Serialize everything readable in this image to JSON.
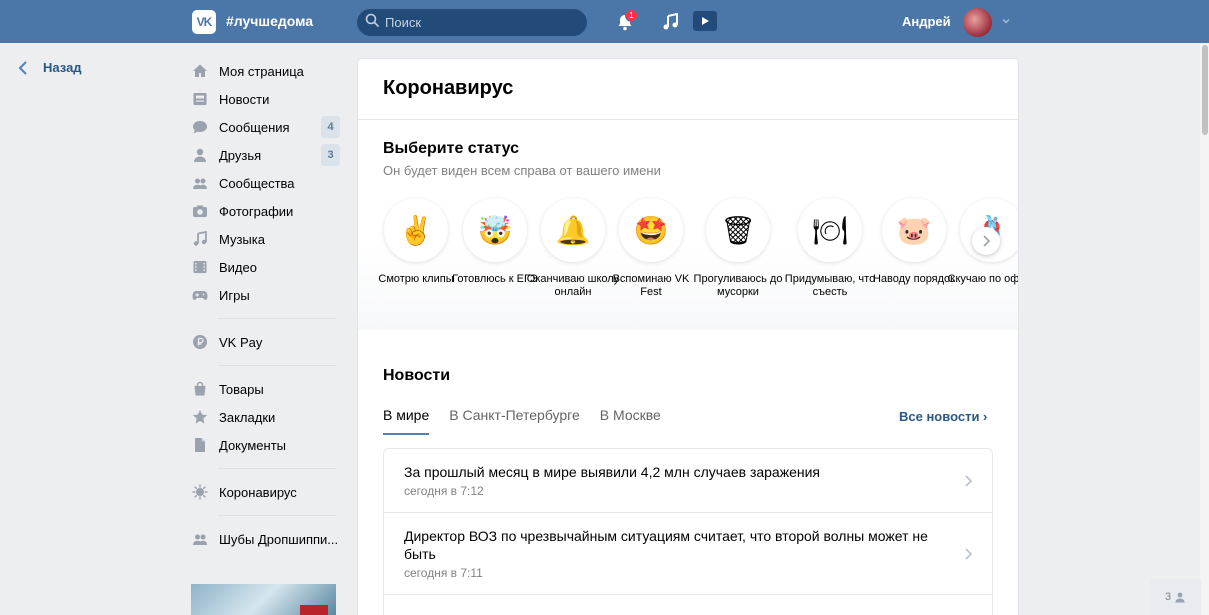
{
  "header": {
    "logo_text": "VK",
    "hashtag": "#лучшедома",
    "search_placeholder": "Поиск",
    "notifications_count": "1",
    "user_name": "Андрей"
  },
  "sidebar": {
    "back_label": "Назад",
    "items": [
      {
        "label": "Моя страница",
        "icon": "home-icon"
      },
      {
        "label": "Новости",
        "icon": "news-icon"
      },
      {
        "label": "Сообщения",
        "icon": "messages-icon",
        "count": "4"
      },
      {
        "label": "Друзья",
        "icon": "friend-icon",
        "count": "3"
      },
      {
        "label": "Сообщества",
        "icon": "groups-icon"
      },
      {
        "label": "Фотографии",
        "icon": "camera-icon"
      },
      {
        "label": "Музыка",
        "icon": "music-icon"
      },
      {
        "label": "Видео",
        "icon": "video-icon"
      },
      {
        "label": "Игры",
        "icon": "gamepad-icon"
      }
    ],
    "vkpay": {
      "label": "VK Pay",
      "icon": "ruble-icon"
    },
    "group2": [
      {
        "label": "Товары",
        "icon": "bag-icon"
      },
      {
        "label": "Закладки",
        "icon": "star-icon"
      },
      {
        "label": "Документы",
        "icon": "document-icon"
      }
    ],
    "corona": {
      "label": "Коронавирус",
      "icon": "virus-icon"
    },
    "group_link": {
      "label": "Шубы Дропшиппи...",
      "icon": "groups-icon"
    }
  },
  "main": {
    "title": "Коронавирус",
    "status": {
      "title": "Выберите статус",
      "subtitle": "Он будет виден всем справа от вашего имени",
      "items": [
        {
          "emoji": "✌",
          "label": "Смотрю клипы"
        },
        {
          "emoji": "🤯",
          "label": "Готовлюсь к ЕГЭ"
        },
        {
          "emoji": "🔔",
          "label": "Оканчиваю школу онлайн"
        },
        {
          "emoji": "🤩",
          "label": "Вспоминаю VK Fest"
        },
        {
          "emoji": "🗑",
          "label": "Прогуливаюсь до мусорки"
        },
        {
          "emoji": "🍽",
          "label": "Придумываю, что съесть"
        },
        {
          "emoji": "🐷",
          "label": "Наводу порядок"
        },
        {
          "emoji": "🪢",
          "label": "Скучаю по офису"
        }
      ]
    },
    "news": {
      "title": "Новости",
      "tabs": [
        "В мире",
        "В Санкт-Петербурге",
        "В Москве"
      ],
      "all_news": "Все новости ›",
      "items": [
        {
          "headline": "За прошлый месяц в мире выявили 4,2 млн случаев заражения",
          "time": "сегодня в 7:12"
        },
        {
          "headline": "Директор ВОЗ по чрезвычайным ситуациям считает, что второй волны может не быть",
          "time": "сегодня в 7:11"
        },
        {
          "headline": "",
          "time": ""
        }
      ]
    }
  },
  "chat_count": "3",
  "colors": {
    "brand": "#4a76a8",
    "link": "#2a5885",
    "badge": "#ff3347"
  }
}
